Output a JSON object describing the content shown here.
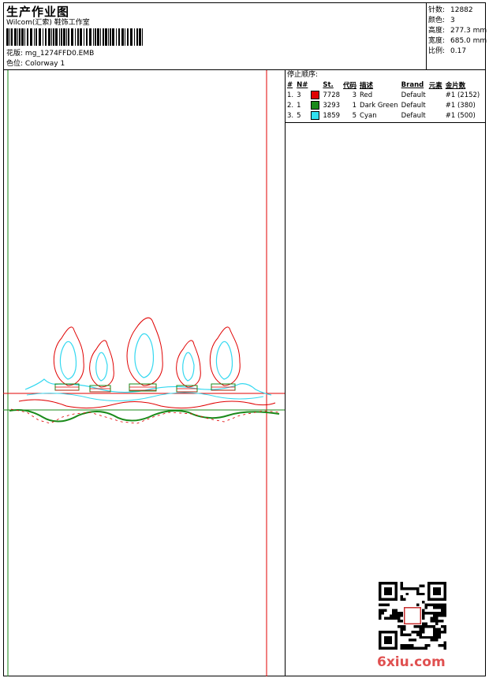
{
  "header": {
    "title": "生产作业图",
    "company": "Wilcom(汇索) 鞋饰工作室",
    "design_label": "花版:",
    "design_value": "mg_1274FFD0.EMB",
    "colorway_label": "色位:",
    "colorway_value": "Colorway 1"
  },
  "stats": [
    {
      "label": "针数:",
      "value": "12882"
    },
    {
      "label": "颜色:",
      "value": "3"
    },
    {
      "label": "高度:",
      "value": "277.3 mm"
    },
    {
      "label": "宽度:",
      "value": "685.0 mm"
    },
    {
      "label": "比例:",
      "value": "0.17"
    }
  ],
  "stop_sequence": {
    "title": "停止顺序:",
    "headers": [
      "#",
      "N#",
      "St.",
      "代码",
      "描述",
      "Brand",
      "元素",
      "金片数"
    ],
    "rows": [
      {
        "idx": "1.",
        "n": "3",
        "st": "7728",
        "code": "3",
        "desc": "Red",
        "brand": "Default",
        "element": "",
        "sequins": "#1 (2152)",
        "color": "#e00000"
      },
      {
        "idx": "2.",
        "n": "1",
        "st": "3293",
        "code": "1",
        "desc": "Dark Green",
        "brand": "Default",
        "element": "",
        "sequins": "#1 (380)",
        "color": "#1a8a1a"
      },
      {
        "idx": "3.",
        "n": "5",
        "st": "1859",
        "code": "5",
        "desc": "Cyan",
        "brand": "Default",
        "element": "",
        "sequins": "#1 (500)",
        "color": "#33e0f0"
      }
    ]
  },
  "watermark": "6xiu.com",
  "colors": {
    "red": "#e00000",
    "green": "#1a8a1a",
    "cyan": "#33d8f0"
  }
}
